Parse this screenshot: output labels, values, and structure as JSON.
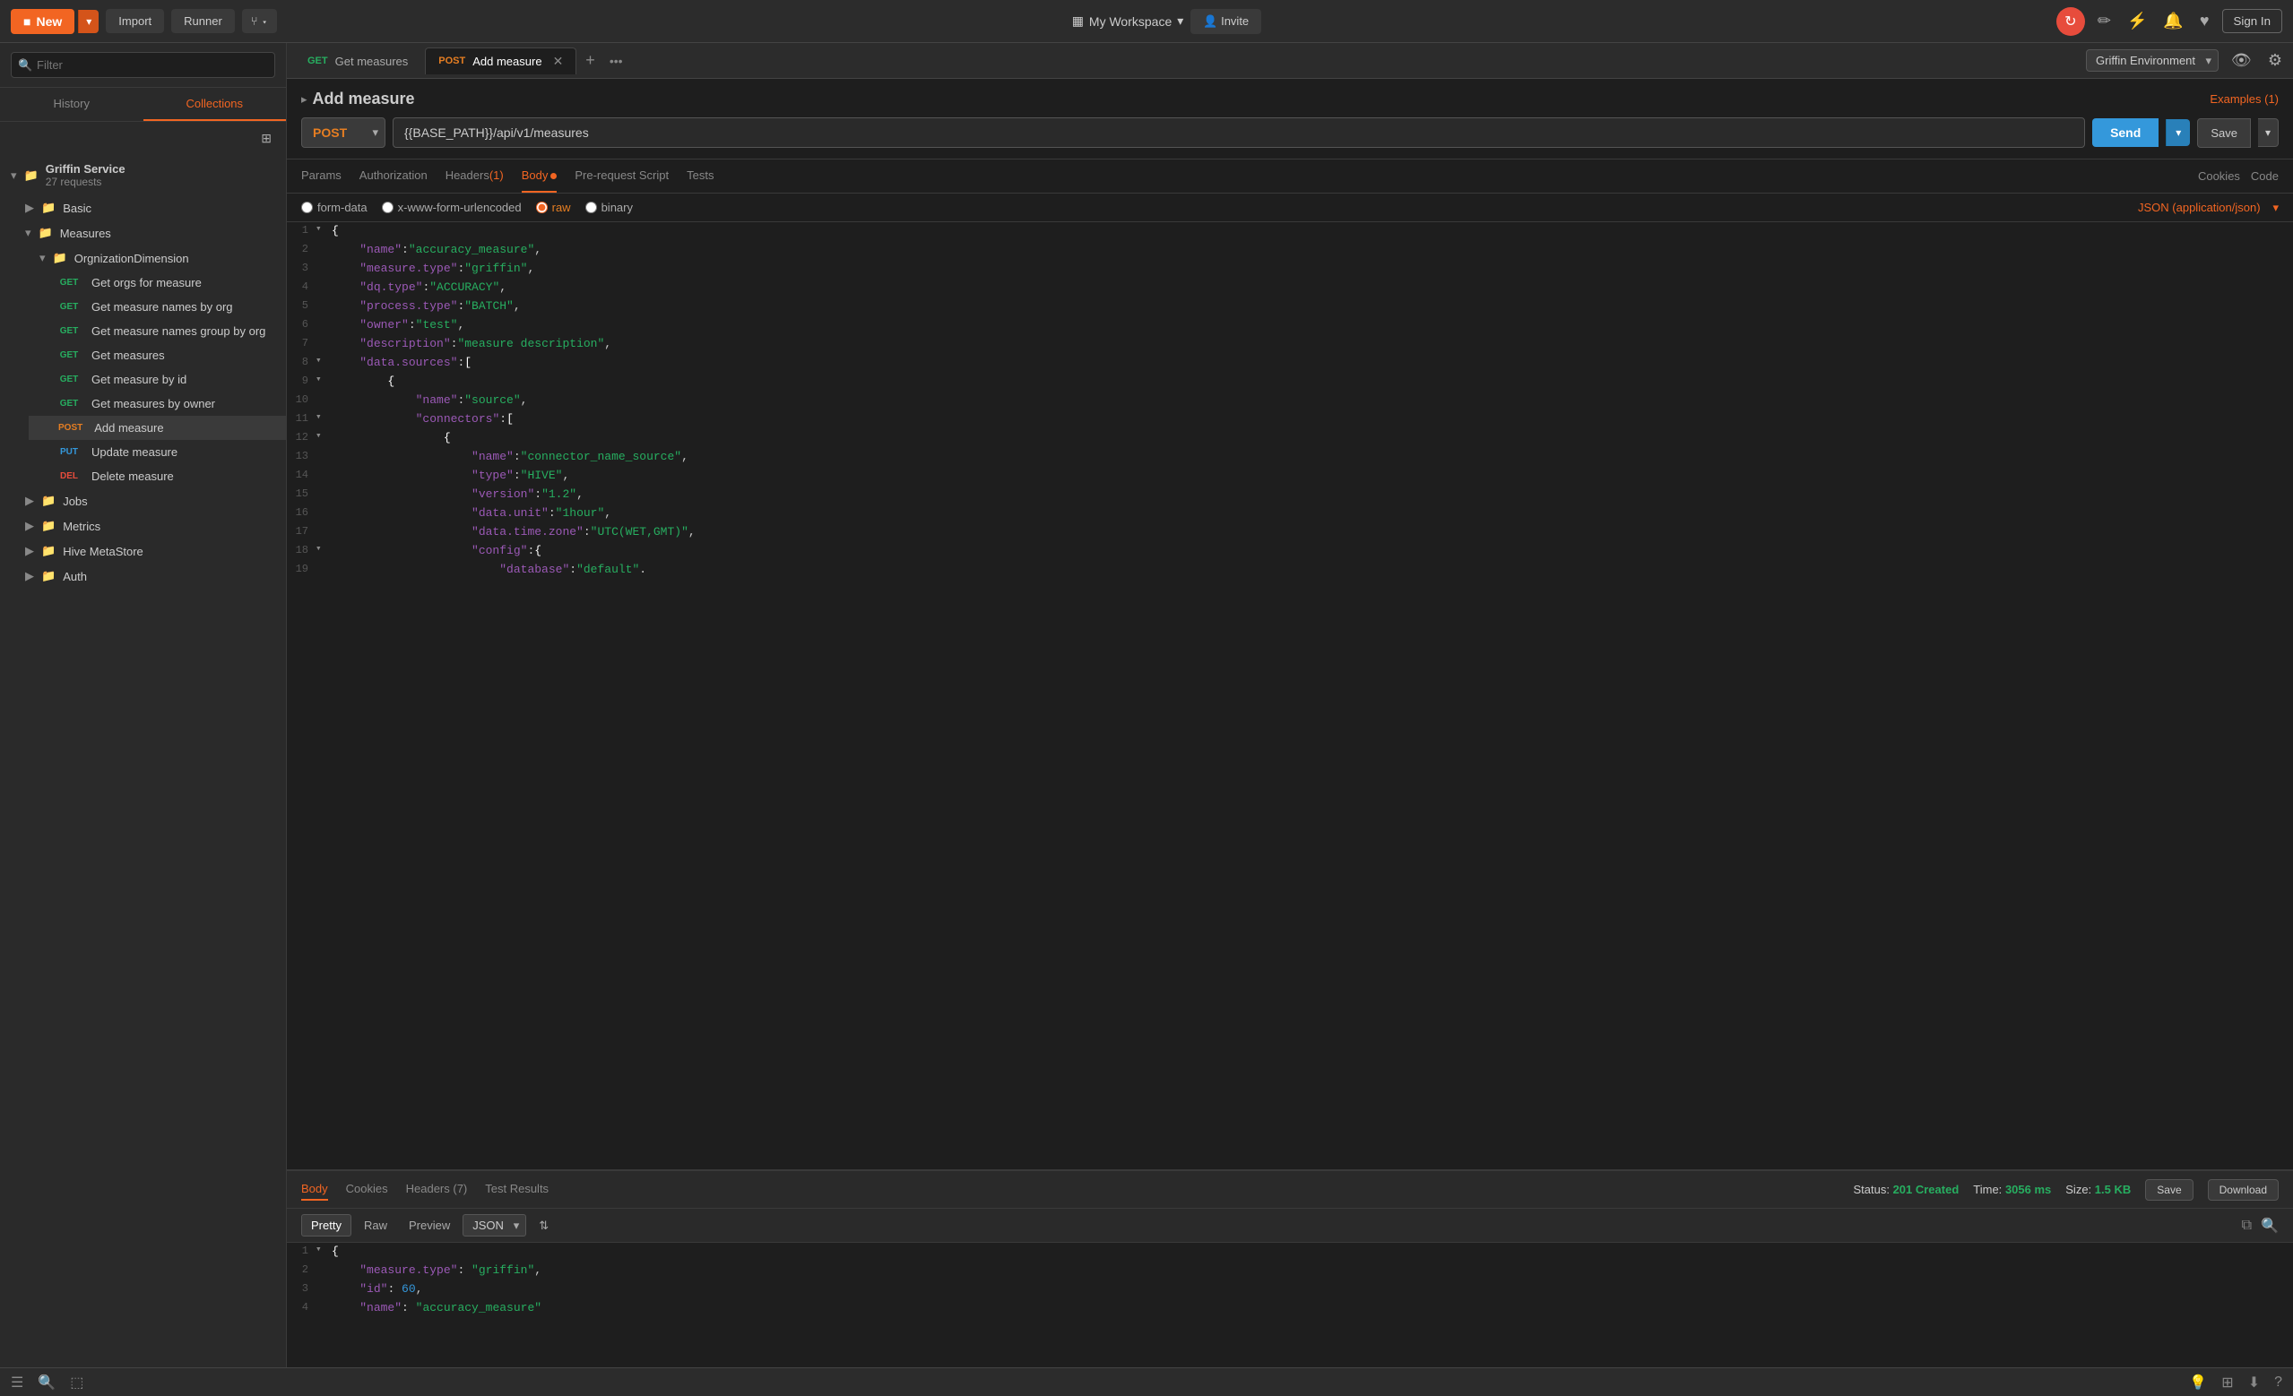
{
  "topNav": {
    "newLabel": "New",
    "importLabel": "Import",
    "runnerLabel": "Runner",
    "workspaceLabel": "My Workspace",
    "inviteLabel": "Invite",
    "signInLabel": "Sign In"
  },
  "sidebar": {
    "searchPlaceholder": "Filter",
    "historyTab": "History",
    "collectionsTab": "Collections",
    "collection": {
      "name": "Griffin Service",
      "count": "27 requests",
      "folders": [
        {
          "name": "Basic",
          "id": "basic",
          "items": []
        },
        {
          "name": "Measures",
          "id": "measures",
          "subFolders": [
            {
              "name": "OrgnizationDimension",
              "id": "org-dim",
              "items": [
                {
                  "method": "GET",
                  "name": "Get orgs for measure"
                },
                {
                  "method": "GET",
                  "name": "Get measure names by org"
                },
                {
                  "method": "GET",
                  "name": "Get measure names group by org"
                },
                {
                  "method": "GET",
                  "name": "Get measures"
                },
                {
                  "method": "GET",
                  "name": "Get measure by id"
                },
                {
                  "method": "GET",
                  "name": "Get measures by owner"
                },
                {
                  "method": "POST",
                  "name": "Add measure",
                  "active": true
                },
                {
                  "method": "PUT",
                  "name": "Update measure"
                },
                {
                  "method": "DEL",
                  "name": "Delete measure"
                }
              ]
            }
          ]
        },
        {
          "name": "Jobs",
          "id": "jobs",
          "items": []
        },
        {
          "name": "Metrics",
          "id": "metrics",
          "items": []
        },
        {
          "name": "Hive MetaStore",
          "id": "hive",
          "items": []
        },
        {
          "name": "Auth",
          "id": "auth",
          "items": []
        }
      ]
    }
  },
  "tabs": [
    {
      "method": "GET",
      "label": "Get measures",
      "active": false
    },
    {
      "method": "POST",
      "label": "Add measure",
      "active": true,
      "closable": true
    }
  ],
  "requestTitle": "Add measure",
  "examplesLink": "Examples (1)",
  "urlBar": {
    "method": "POST",
    "url": "{{BASE_PATH}}/api/v1/measures"
  },
  "requestTabs": {
    "params": "Params",
    "authorization": "Authorization",
    "headers": "Headers",
    "headersCount": "(1)",
    "body": "Body",
    "preRequestScript": "Pre-request Script",
    "tests": "Tests",
    "cookies": "Cookies",
    "code": "Code"
  },
  "bodyOptions": {
    "formData": "form-data",
    "urlEncoded": "x-www-form-urlencoded",
    "raw": "raw",
    "binary": "binary",
    "jsonType": "JSON (application/json)"
  },
  "codeLines": [
    {
      "num": 1,
      "toggle": "▾",
      "content": "{"
    },
    {
      "num": 2,
      "toggle": "",
      "content": "    \"name\":\"accuracy_measure\","
    },
    {
      "num": 3,
      "toggle": "",
      "content": "    \"measure.type\":\"griffin\","
    },
    {
      "num": 4,
      "toggle": "",
      "content": "    \"dq.type\":\"ACCURACY\","
    },
    {
      "num": 5,
      "toggle": "",
      "content": "    \"process.type\":\"BATCH\","
    },
    {
      "num": 6,
      "toggle": "",
      "content": "    \"owner\":\"test\","
    },
    {
      "num": 7,
      "toggle": "",
      "content": "    \"description\":\"measure description\","
    },
    {
      "num": 8,
      "toggle": "▾",
      "content": "    \"data.sources\":["
    },
    {
      "num": 9,
      "toggle": "▾",
      "content": "        {"
    },
    {
      "num": 10,
      "toggle": "",
      "content": "            \"name\":\"source\","
    },
    {
      "num": 11,
      "toggle": "▾",
      "content": "            \"connectors\":["
    },
    {
      "num": 12,
      "toggle": "▾",
      "content": "                {"
    },
    {
      "num": 13,
      "toggle": "",
      "content": "                    \"name\":\"connector_name_source\","
    },
    {
      "num": 14,
      "toggle": "",
      "content": "                    \"type\":\"HIVE\","
    },
    {
      "num": 15,
      "toggle": "",
      "content": "                    \"version\":\"1.2\","
    },
    {
      "num": 16,
      "toggle": "",
      "content": "                    \"data.unit\":\"1hour\","
    },
    {
      "num": 17,
      "toggle": "",
      "content": "                    \"data.time.zone\":\"UTC(WET,GMT)\","
    },
    {
      "num": 18,
      "toggle": "▾",
      "content": "                    \"config\":{"
    },
    {
      "num": 19,
      "toggle": "",
      "content": "                        \"database\":\"default\"."
    }
  ],
  "responseTabs": {
    "body": "Body",
    "cookies": "Cookies",
    "headers": "Headers (7)",
    "testResults": "Test Results"
  },
  "responseStatus": {
    "statusLabel": "Status:",
    "status": "201 Created",
    "timeLabel": "Time:",
    "time": "3056 ms",
    "sizeLabel": "Size:",
    "size": "1.5 KB"
  },
  "responseButtons": {
    "save": "Save",
    "download": "Download"
  },
  "responseFormats": {
    "pretty": "Pretty",
    "raw": "Raw",
    "preview": "Preview",
    "jsonType": "JSON"
  },
  "responseLines": [
    {
      "num": 1,
      "toggle": "▾",
      "content": "{"
    },
    {
      "num": 2,
      "toggle": "",
      "content": "    \"measure.type\": \"griffin\","
    },
    {
      "num": 3,
      "toggle": "",
      "content": "    \"id\": 60,"
    },
    {
      "num": 4,
      "toggle": "",
      "content": "    \"name\": \"accuracy_measure\""
    }
  ],
  "environment": {
    "label": "Griffin Environment"
  }
}
